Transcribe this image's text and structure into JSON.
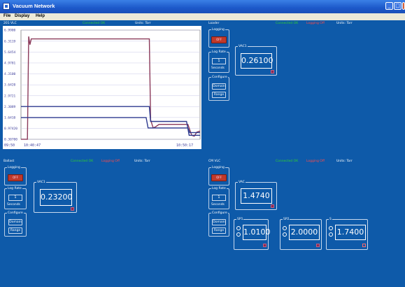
{
  "window": {
    "title": "Vacuum Network",
    "minimize": "_",
    "maximize": "□",
    "close": "×"
  },
  "menu": [
    "File",
    "Display",
    "Help"
  ],
  "panels": {
    "p201": {
      "title": "201 VLC",
      "status_green": "Connected OK",
      "status_red": "",
      "units": "Units: Torr"
    },
    "loader": {
      "title": "Loader",
      "status_green": "Connected OK",
      "status_red": "Logging Off",
      "units": "Units: Torr"
    },
    "ballast": {
      "title": "Ballast",
      "status_green": "Connected OK",
      "status_red": "Logging Off",
      "units": "Units: Torr"
    },
    "cm": {
      "title": "CM VLC",
      "status_green": "Connected OK",
      "status_red": "Logging Off",
      "units": "Units: Torr"
    }
  },
  "common": {
    "logging": "Logging",
    "log_rate": "Log Rate",
    "seconds": "Seconds",
    "configure": "Configure",
    "domain": "Domain",
    "range": "Range",
    "led_label": "OFF"
  },
  "loader": {
    "rate": "1",
    "vac1_label": "VAC1",
    "vac1_value": "0.26100"
  },
  "ballast": {
    "rate": "1",
    "vac1_label": "VAC1",
    "vac1_value": "0.23200"
  },
  "cm": {
    "rate": "1",
    "vac_label": "VAC",
    "vac_value": "1.4740",
    "sp1_label": "SP1",
    "sp1_value": "1.0100",
    "sp2_label": "SP2",
    "sp2_value": "2.0000",
    "s_label": "S",
    "s_value": "1.7400"
  },
  "chart_data": {
    "type": "line",
    "title": "",
    "xlabel": "",
    "ylabel": "",
    "x_ticks": [
      "09:50",
      "10:40:47",
      "10:50:17"
    ],
    "y_ticks": [
      "0.30700",
      "0.97420",
      "1.6410",
      "2.3089",
      "2.9721",
      "3.6420",
      "4.3100",
      "4.9781",
      "5.6454",
      "6.3119",
      "6.9900"
    ],
    "ylim": [
      0.307,
      6.99
    ],
    "grid": true,
    "series": [
      {
        "color": "#8b3a5a",
        "points": [
          [
            0,
            0.31
          ],
          [
            10,
            0.31
          ],
          [
            12,
            6.6
          ],
          [
            14,
            6.1
          ],
          [
            16,
            6.45
          ],
          [
            200,
            6.45
          ],
          [
            202,
            1.5
          ],
          [
            206,
            1.0
          ],
          [
            210,
            1.08
          ],
          [
            215,
            1.22
          ],
          [
            260,
            1.22
          ],
          [
            262,
            1.0
          ],
          [
            266,
            0.55
          ],
          [
            270,
            0.5
          ],
          [
            274,
            0.75
          ],
          [
            278,
            0.8
          ],
          [
            279,
            0.8
          ]
        ]
      },
      {
        "color": "#2e3a8f",
        "points": [
          [
            0,
            1.64
          ],
          [
            195,
            1.64
          ],
          [
            198,
            1.0
          ],
          [
            260,
            1.0
          ],
          [
            263,
            0.72
          ],
          [
            279,
            0.72
          ]
        ]
      },
      {
        "color": "#2e3a8f",
        "points": [
          [
            0,
            2.31
          ],
          [
            200,
            2.31
          ],
          [
            202,
            1.4
          ],
          [
            258,
            1.4
          ],
          [
            262,
            0.55
          ],
          [
            279,
            0.55
          ]
        ]
      }
    ]
  }
}
